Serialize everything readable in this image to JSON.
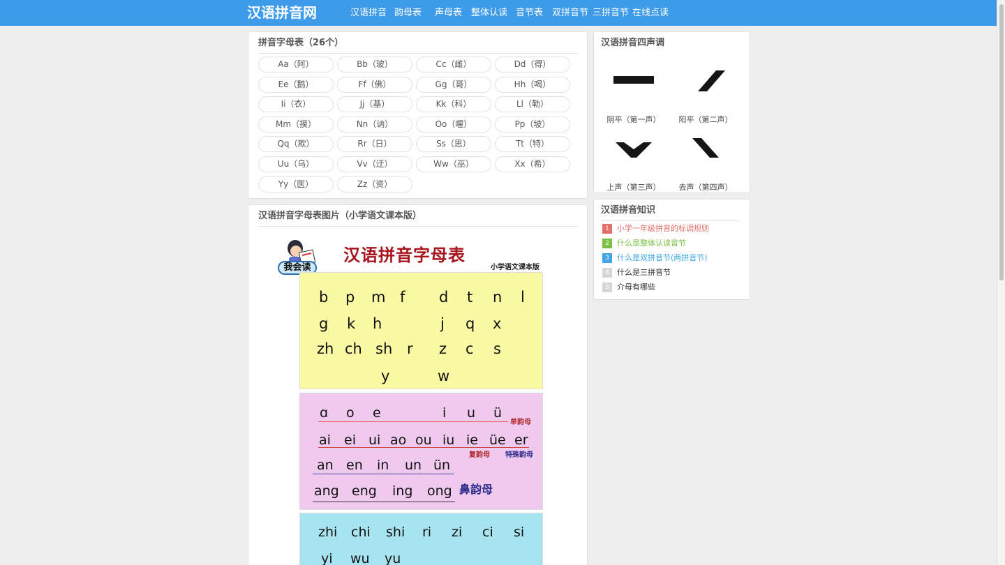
{
  "header": {
    "logo": "汉语拼音网",
    "nav": [
      "汉语拼音",
      "韵母表",
      "声母表",
      "整体认读",
      "音节表",
      "双拼音节",
      "三拼音节",
      "在线点读"
    ]
  },
  "alphabet": {
    "title": "拼音字母表（26个）",
    "letters": [
      "Aa（阿）",
      "Bb（玻）",
      "Cc（雌）",
      "Dd（得）",
      "Ee（鹅）",
      "Ff（佛）",
      "Gg（哥）",
      "Hh（喝）",
      "Ii（衣）",
      "Jj（基）",
      "Kk（科）",
      "Ll（勒）",
      "Mm（摸）",
      "Nn（讷）",
      "Oo（喔）",
      "Pp（坡）",
      "Qq（欺）",
      "Rr（日）",
      "Ss（思）",
      "Tt（特）",
      "Uu（乌）",
      "Vv（迂）",
      "Ww（巫）",
      "Xx（希）",
      "Yy（医）",
      "Zz（资）"
    ]
  },
  "picture_panel": {
    "title": "汉语拼音字母表图片（小学语文课本版）",
    "badge": "我会读",
    "picture_title": "汉语拼音字母表",
    "picture_subtitle": "小学语文课本版",
    "initials": [
      [
        "b",
        "p",
        "m",
        "f",
        "d",
        "t",
        "n",
        "l"
      ],
      [
        "g",
        "k",
        "h",
        "j",
        "q",
        "x"
      ],
      [
        "zh",
        "ch",
        "sh",
        "r",
        "z",
        "c",
        "s"
      ],
      [
        "y",
        "w"
      ]
    ],
    "finals": {
      "simple": [
        "ɑ",
        "o",
        "e",
        "i",
        "u",
        "ü"
      ],
      "simple_tag": "单韵母",
      "compound": [
        "ai",
        "ei",
        "ui",
        "ao",
        "ou",
        "iu",
        "ie",
        "üe",
        "er"
      ],
      "compound_tag": "复韵母",
      "special_tag": "特殊韵母",
      "front_nasal": [
        "an",
        "en",
        "in",
        "un",
        "ün"
      ],
      "back_nasal": [
        "ang",
        "eng",
        "ing",
        "ong"
      ],
      "nasal_tag": "鼻韵母"
    },
    "whole_syllables": [
      [
        "zhi",
        "chi",
        "shi",
        "ri",
        "zi",
        "ci",
        "si"
      ],
      [
        "yi",
        "wu",
        "yu"
      ]
    ]
  },
  "tones": {
    "title": "汉语拼音四声调",
    "items": [
      {
        "label": "阴平（第一声）",
        "icon": "first-tone-icon"
      },
      {
        "label": "阳平（第二声）",
        "icon": "second-tone-icon"
      },
      {
        "label": "上声（第三声）",
        "icon": "third-tone-icon"
      },
      {
        "label": "去声（第四声）",
        "icon": "fourth-tone-icon"
      }
    ]
  },
  "knowledge": {
    "title": "汉语拼音知识",
    "items": [
      {
        "num": "1",
        "text": "小学一年级拼音的标调规则",
        "color": "#e2706a"
      },
      {
        "num": "2",
        "text": "什么是整体认读音节",
        "color": "#7ac143"
      },
      {
        "num": "3",
        "text": "什么是双拼音节(两拼音节)",
        "color": "#3fa5e6"
      },
      {
        "num": "4",
        "text": "什么是三拼音节",
        "color": "#333333"
      },
      {
        "num": "5",
        "text": "介母有哪些",
        "color": "#333333"
      }
    ],
    "rank_colors": [
      "#e2706a",
      "#7ac143",
      "#3fa5e6",
      "#d6d6d6",
      "#d6d6d6"
    ]
  },
  "colors": {
    "header": "#3d9be9",
    "initials_bg": "#fafaa4",
    "finals_bg": "#f0c9ee",
    "syllables_bg": "#a8e4f0",
    "picture_title": "#a8141c"
  }
}
